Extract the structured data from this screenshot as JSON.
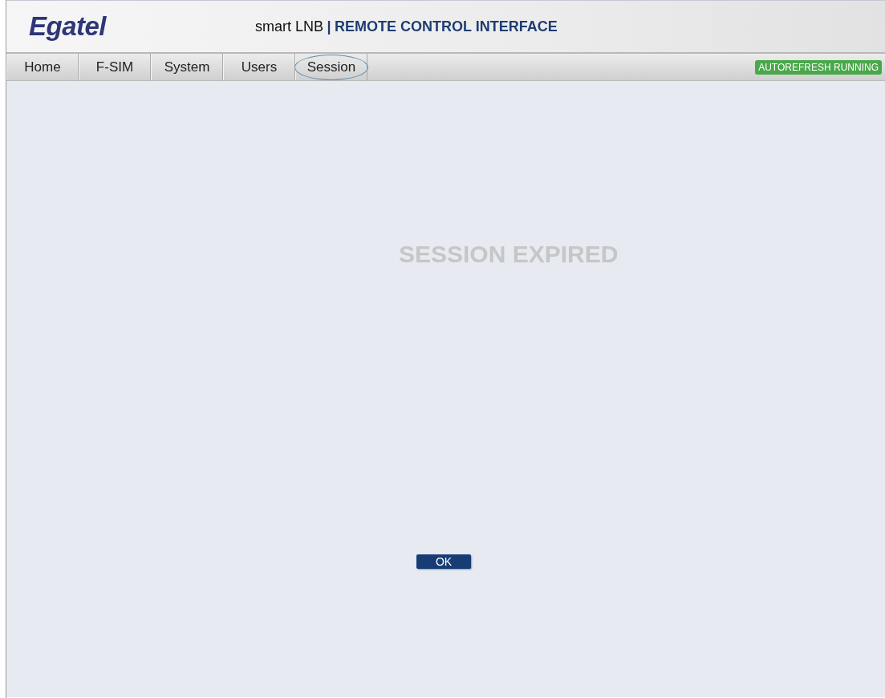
{
  "header": {
    "logo": "Egatel",
    "product": "smart LNB",
    "separator": "|",
    "title": "REMOTE CONTROL INTERFACE"
  },
  "tabs": [
    {
      "label": "Home",
      "selected": false
    },
    {
      "label": "F-SIM",
      "selected": false
    },
    {
      "label": "System",
      "selected": false
    },
    {
      "label": "Users",
      "selected": false
    },
    {
      "label": "Session",
      "selected": true
    }
  ],
  "status_badge": "AUTOREFRESH RUNNING",
  "message": "SESSION EXPIRED",
  "buttons": [
    "OK"
  ]
}
